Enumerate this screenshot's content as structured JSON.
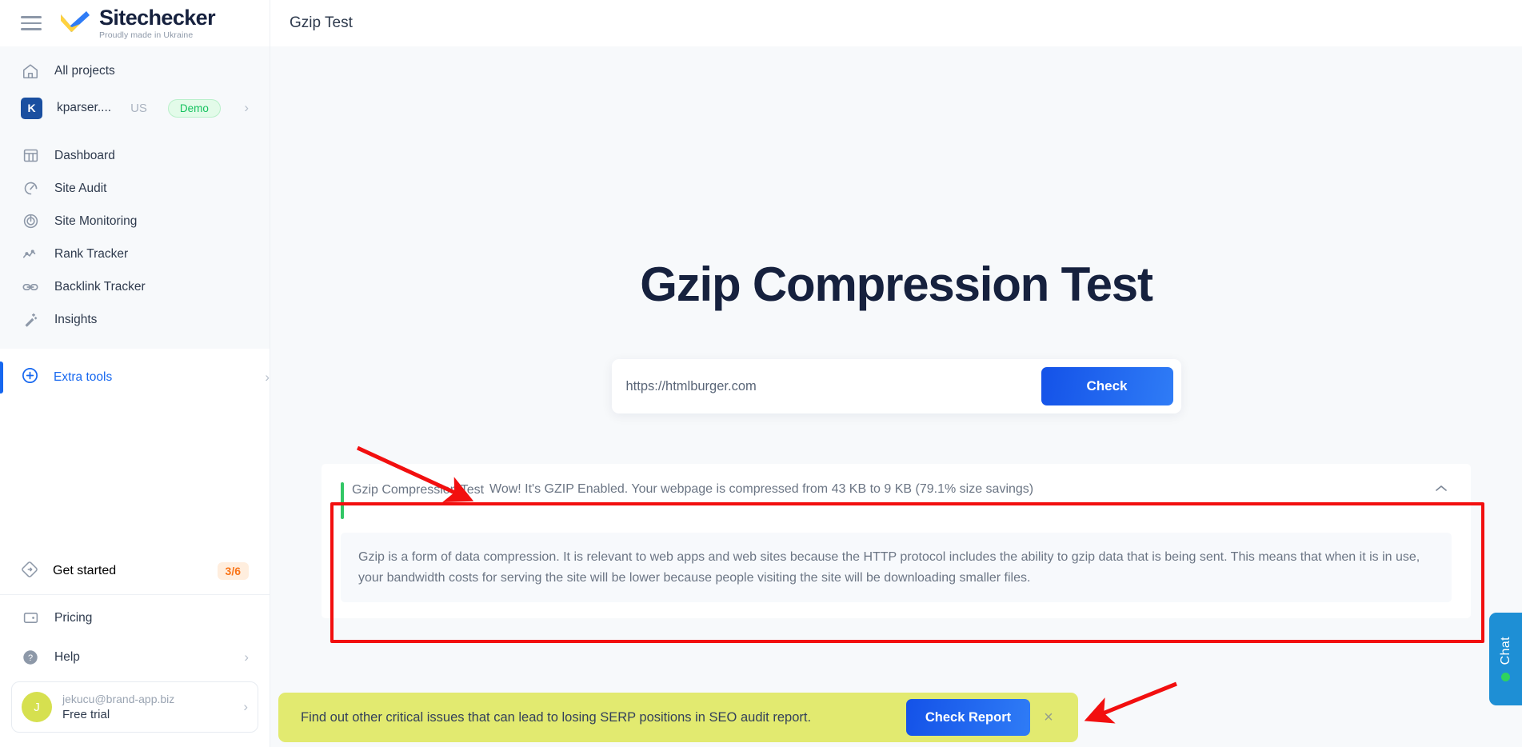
{
  "brand": {
    "name": "Sitechecker",
    "tagline": "Proudly made in Ukraine"
  },
  "header": {
    "title": "Gzip Test"
  },
  "sidebar": {
    "all_projects_label": "All projects",
    "project": {
      "initial": "K",
      "name": "kparser....",
      "country": "US",
      "badge": "Demo"
    },
    "menu": [
      {
        "label": "Dashboard",
        "icon": "dashboard-icon"
      },
      {
        "label": "Site Audit",
        "icon": "site-audit-icon"
      },
      {
        "label": "Site Monitoring",
        "icon": "site-monitoring-icon"
      },
      {
        "label": "Rank Tracker",
        "icon": "rank-tracker-icon"
      },
      {
        "label": "Backlink Tracker",
        "icon": "backlink-tracker-icon"
      },
      {
        "label": "Insights",
        "icon": "insights-icon"
      }
    ],
    "extra_tools": {
      "label": "Extra tools",
      "icon": "plus-circle-icon"
    },
    "get_started": {
      "label": "Get started",
      "count": "3/6",
      "icon": "compass-icon"
    },
    "bottom": [
      {
        "label": "Pricing",
        "icon": "wallet-icon",
        "chevron": false
      },
      {
        "label": "Help",
        "icon": "help-icon",
        "chevron": true
      }
    ],
    "user": {
      "initial": "J",
      "email": "jekucu@brand-app.biz",
      "plan": "Free trial"
    }
  },
  "main": {
    "hero_title": "Gzip Compression Test",
    "search": {
      "value": "https://htmlburger.com",
      "placeholder": "https://htmlburger.com",
      "button_label": "Check"
    },
    "result": {
      "label": "Gzip Compression Test",
      "message": "Wow! It's GZIP Enabled. Your webpage is compressed from 43 KB to 9 KB (79.1% size savings)",
      "status_color": "#32c766",
      "description": "Gzip is a form of data compression. It is relevant to web apps and web sites because the HTTP protocol includes the ability to gzip data that is being sent. This means that when it is in use, your bandwidth costs for serving the site will be lower because people visiting the site will be downloading smaller files."
    },
    "banner": {
      "text": "Find out other critical issues that can lead to losing SERP positions in SEO audit report.",
      "button_label": "Check Report",
      "close_label": "×",
      "background": "#e2ea70"
    },
    "chat": {
      "label": "Chat",
      "status_color": "#2fd35f",
      "background": "#1e8fd5"
    }
  },
  "accent": {
    "primary": "#1667ef",
    "annotation": "#f20f0f"
  }
}
